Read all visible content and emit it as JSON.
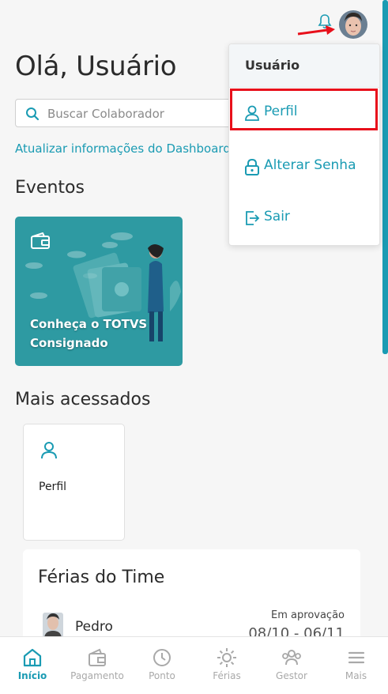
{
  "header": {
    "greeting": "Olá, Usuário"
  },
  "search": {
    "placeholder": "Buscar Colaborador"
  },
  "dashboard": {
    "update_link": "Atualizar informações do Dashboard"
  },
  "events": {
    "title": "Eventos",
    "cards": [
      {
        "caption": "Conheça o TOTVS Consignado",
        "background": "#2e9aa2"
      }
    ]
  },
  "most_accessed": {
    "title": "Mais acessados",
    "items": [
      {
        "label": "Perfil",
        "icon": "user-icon"
      }
    ]
  },
  "team_vacations": {
    "title": "Férias do Time",
    "entries": [
      {
        "name": "Pedro",
        "status": "Em aprovação",
        "dates": "08/10 - 06/11"
      }
    ]
  },
  "user_menu": {
    "header": "Usuário",
    "items": [
      {
        "label": "Perfil",
        "icon": "user-icon"
      },
      {
        "label": "Alterar Senha",
        "icon": "lock-icon"
      },
      {
        "label": "Sair",
        "icon": "logout-icon"
      }
    ]
  },
  "bottom_nav": {
    "items": [
      {
        "label": "Início",
        "icon": "home-icon",
        "active": true
      },
      {
        "label": "Pagamento",
        "icon": "wallet-icon",
        "active": false
      },
      {
        "label": "Ponto",
        "icon": "clock-icon",
        "active": false
      },
      {
        "label": "Férias",
        "icon": "sun-icon",
        "active": false
      },
      {
        "label": "Gestor",
        "icon": "team-icon",
        "active": false
      },
      {
        "label": "Mais",
        "icon": "menu-icon",
        "active": false
      }
    ]
  },
  "colors": {
    "accent": "#1a9bb3",
    "highlight": "#e8101b",
    "card": "#2e9aa2"
  }
}
